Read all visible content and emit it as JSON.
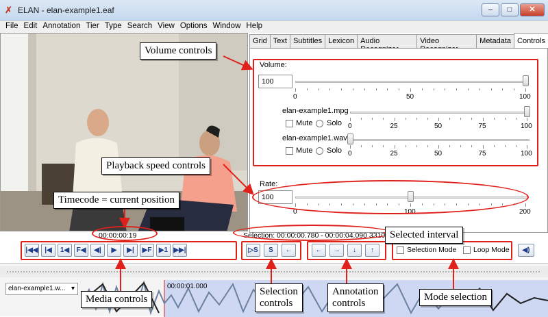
{
  "window": {
    "title": "ELAN - elan-example1.eaf",
    "app_icon": "elan-x-icon",
    "min": "–",
    "max": "□",
    "close": "✕"
  },
  "menu": [
    "File",
    "Edit",
    "Annotation",
    "Tier",
    "Type",
    "Search",
    "View",
    "Options",
    "Window",
    "Help"
  ],
  "tabs": [
    "Grid",
    "Text",
    "Subtitles",
    "Lexicon",
    "Audio Recognizer",
    "Video Recognizer",
    "Metadata",
    "Controls"
  ],
  "active_tab": "Controls",
  "controls": {
    "volume_label": "Volume:",
    "volume_value": "100",
    "volume_ticks": [
      "0",
      "50",
      "100"
    ],
    "volume_level": 1.0,
    "tracks": [
      {
        "name": "elan-example1.mpg",
        "mute": "Mute",
        "solo": "Solo",
        "level": 1.0
      },
      {
        "name": "elan-example1.wav",
        "mute": "Mute",
        "solo": "Solo",
        "level": 0.0
      }
    ],
    "track_ticks": [
      "0",
      "25",
      "50",
      "75",
      "100"
    ],
    "rate_label": "Rate:",
    "rate_value": "100",
    "rate_ticks": [
      "0",
      "100",
      "200"
    ],
    "rate_level": 0.5
  },
  "timecode": "00:00:00:19",
  "selection_text": "Selection: 00:00:00.780 - 00:00:04.090  3310",
  "media_buttons": [
    "|◀◀",
    "|◀",
    "1◀",
    "F◀",
    "◀|",
    "▶",
    "▶|",
    "▶F",
    "▶1",
    "▶▶|"
  ],
  "selection_buttons": [
    "▷S",
    "S",
    "←"
  ],
  "annotation_buttons": [
    "←",
    "→",
    "↓",
    "↑"
  ],
  "mode": {
    "selection_mode": "Selection Mode",
    "loop_mode": "Loop Mode",
    "speaker": "speaker-icon"
  },
  "timeline": {
    "tier_name": "elan-example1.w...",
    "time_label": "00:00:01.000"
  },
  "callouts": {
    "volume": "Volume controls",
    "playback": "Playback speed controls",
    "timecode": "Timecode = current position",
    "selected_interval": "Selected interval",
    "media": "Media controls",
    "selection_ctl": "Selection\ncontrols",
    "annotation_ctl": "Annotation\ncontrols",
    "mode": "Mode selection"
  },
  "colors": {
    "accent_red": "#e0201b",
    "selection_blue": "#cfd8f2",
    "waveform": "#6b7f9e"
  }
}
